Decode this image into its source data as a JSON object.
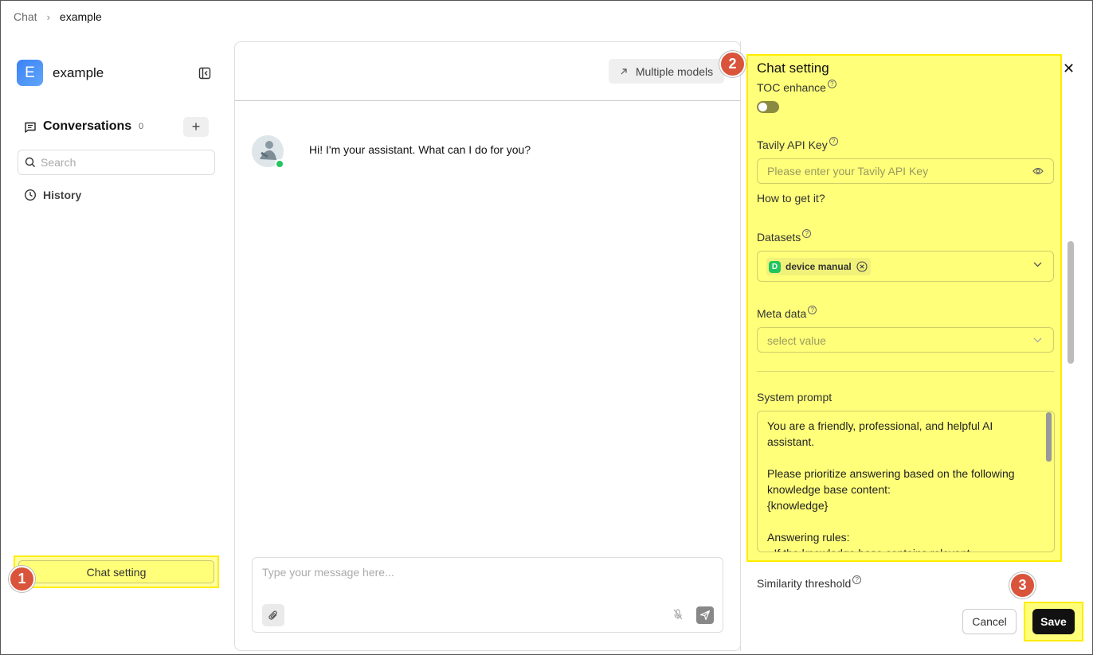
{
  "breadcrumb": {
    "root": "Chat",
    "current": "example"
  },
  "app": {
    "avatar_letter": "E",
    "name": "example"
  },
  "sidebar": {
    "conversations_title": "Conversations",
    "conversations_count": "0",
    "search_placeholder": "Search",
    "history_label": "History",
    "chat_setting_label": "Chat setting"
  },
  "chat": {
    "multiple_models_label": "Multiple models",
    "greeting": "Hi! I'm your assistant. What can I do for you?",
    "input_placeholder": "Type your message here..."
  },
  "settings": {
    "title": "Chat setting",
    "toc_enhance_label": "TOC enhance",
    "toc_enhance_enabled": false,
    "tavily_label": "Tavily API Key",
    "tavily_placeholder": "Please enter your Tavily API Key",
    "how_to_get": "How to get it?",
    "datasets_label": "Datasets",
    "dataset_tag": {
      "letter": "D",
      "name": "device manual"
    },
    "meta_label": "Meta data",
    "meta_placeholder": "select value",
    "system_prompt_label": "System prompt",
    "system_prompt": "You are a friendly, professional, and helpful AI assistant.\n\nPlease prioritize answering based on the following knowledge base content:\n{knowledge}\n\nAnswering rules:\n- If the knowledge base contains relevant",
    "similarity_label": "Similarity threshold",
    "cancel_label": "Cancel",
    "save_label": "Save"
  },
  "annotations": {
    "badge1": "1",
    "badge2": "2",
    "badge3": "3"
  },
  "colors": {
    "highlight": "#ffff7a",
    "badge": "#d9543a",
    "online": "#22c55e",
    "save_bg": "#111111"
  }
}
